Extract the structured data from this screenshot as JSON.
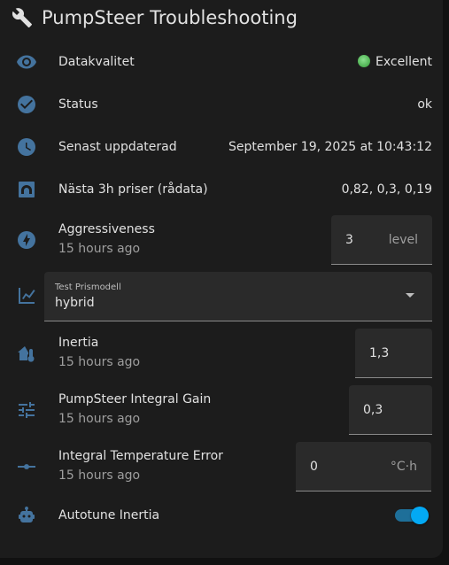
{
  "header": {
    "title": "PumpSteer Troubleshooting",
    "icon": "wrench-icon"
  },
  "accent_color": "#03a9f4",
  "icon_color": "#44739e",
  "rows": [
    {
      "label": "Datakvalitet",
      "value": "Excellent",
      "icon": "eye-icon",
      "status_color": "#4caf50"
    },
    {
      "label": "Status",
      "value": "ok",
      "icon": "check-circle-icon"
    },
    {
      "label": "Senast uppdaterad",
      "value": "September 19, 2025 at 10:43:12",
      "icon": "clock-icon"
    },
    {
      "label": "Nästa 3h priser (rådata)",
      "value": "0,82, 0,3, 0,19",
      "icon": "gauge-icon"
    }
  ],
  "aggressiveness": {
    "label": "Aggressiveness",
    "sub": "15 hours ago",
    "value": "3",
    "unit": "level",
    "icon": "lightning-icon"
  },
  "prismodell": {
    "label": "Test Prismodell",
    "value": "hybrid",
    "icon": "chart-line-icon"
  },
  "inertia": {
    "label": "Inertia",
    "sub": "15 hours ago",
    "value": "1,3",
    "icon": "home-thermometer-icon"
  },
  "integral_gain": {
    "label": "PumpSteer Integral Gain",
    "sub": "15 hours ago",
    "value": "0,3",
    "icon": "tune-icon"
  },
  "integral_error": {
    "label": "Integral Temperature Error",
    "sub": "15 hours ago",
    "value": "0",
    "unit": "°C·h",
    "icon": "ray-vertex-icon"
  },
  "autotune": {
    "label": "Autotune Inertia",
    "state": "on",
    "icon": "robot-icon"
  }
}
